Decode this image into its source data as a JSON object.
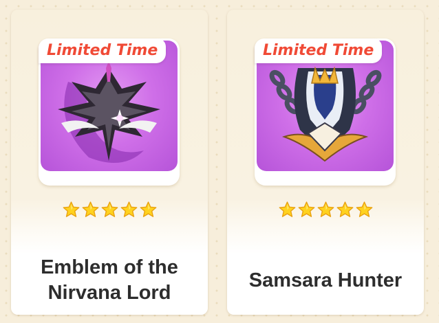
{
  "cards": [
    {
      "badge": "Limited Time",
      "icon": "emblem-of-the-nirvana-lord-icon",
      "stars": 5,
      "title": "Emblem of the Nirvana Lord"
    },
    {
      "badge": "Limited Time",
      "icon": "samsara-hunter-icon",
      "stars": 5,
      "title": "Samsara Hunter"
    }
  ],
  "colors": {
    "badge_text": "#f04a36",
    "star": "#ffd21f",
    "icon_background": "#cf6fe8",
    "page_background": "#f7eedb"
  }
}
